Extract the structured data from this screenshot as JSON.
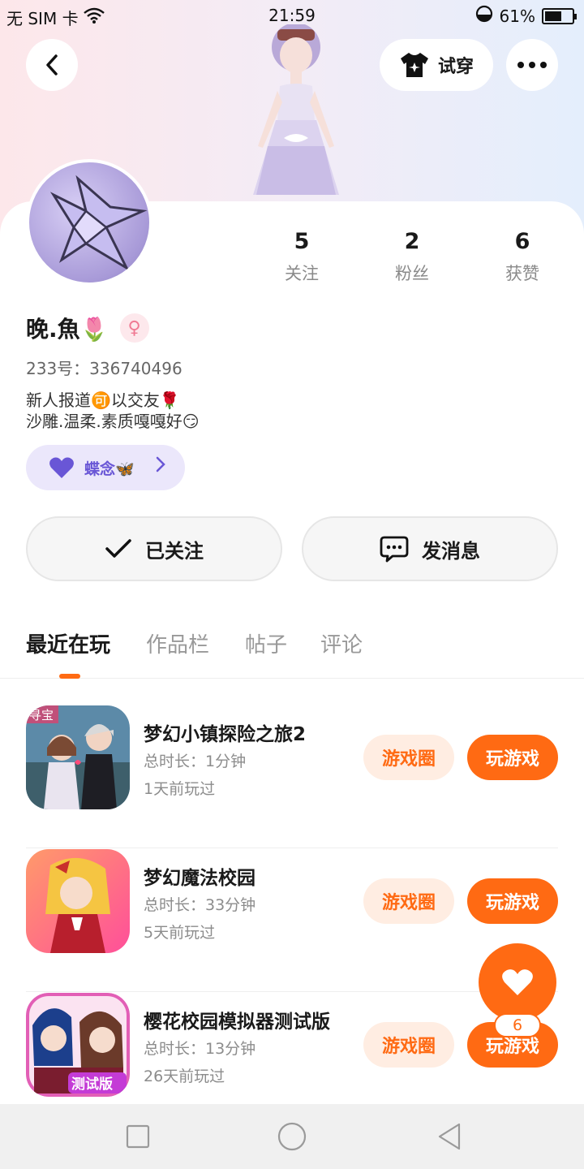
{
  "status_bar": {
    "carrier": "无 SIM 卡",
    "time": "21:59",
    "battery": "61%",
    "battery_level": 0.61
  },
  "header": {
    "tryon_label": "试穿",
    "icons": [
      "back-arrow-icon",
      "tshirt-icon",
      "more-icon"
    ]
  },
  "profile": {
    "stats": [
      {
        "value": "5",
        "label": "关注"
      },
      {
        "value": "2",
        "label": "粉丝"
      },
      {
        "value": "6",
        "label": "获赞"
      }
    ],
    "name": "晚.魚🌷",
    "gender_symbol": "♀",
    "uid": "233号：336740496",
    "bio": [
      "新人报道🉑以交友🌹",
      "沙雕.温柔.素质嘎嘎好😏"
    ],
    "badge_label": "蝶念🦋",
    "follow_label": "已关注",
    "message_label": "发消息"
  },
  "tabs": [
    {
      "label": "最近在玩",
      "active": true
    },
    {
      "label": "作品栏",
      "active": false
    },
    {
      "label": "帖子",
      "active": false
    },
    {
      "label": "评论",
      "active": false
    }
  ],
  "games": [
    {
      "title": "梦幻小镇探险之旅2",
      "duration": "总时长：1分钟",
      "last_played": "1天前玩过",
      "circle_label": "游戏圈",
      "play_label": "玩游戏",
      "icon_label": "寻宝"
    },
    {
      "title": "梦幻魔法校园",
      "duration": "总时长：33分钟",
      "last_played": "5天前玩过",
      "circle_label": "游戏圈",
      "play_label": "玩游戏"
    },
    {
      "title": "樱花校园模拟器测试版",
      "duration": "总时长：13分钟",
      "last_played": "26天前玩过",
      "circle_label": "游戏圈",
      "play_label": "玩游戏",
      "icon_label": "测试版"
    }
  ],
  "fab": {
    "count": "6"
  },
  "colors": {
    "accent": "#ff6a13",
    "badge": "#6956d6"
  }
}
